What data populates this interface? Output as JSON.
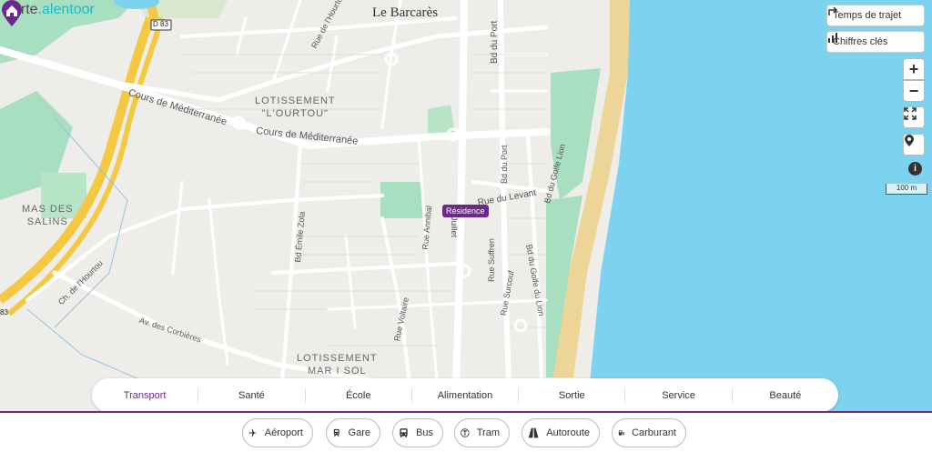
{
  "logo": {
    "part1": "carte",
    "dot": ".",
    "part2": "alentoor"
  },
  "city": "Le Barcarès",
  "controls": {
    "travel_time": "Temps de trajet",
    "key_figures": "Chiffres clés",
    "zoom_in": "+",
    "zoom_out": "−",
    "scale": "100 m"
  },
  "map_labels": {
    "d83": "D 83",
    "d83b": "83",
    "rue_hourtou": "Rue de l'Hourtou",
    "bd_port_top": "Bd du Port",
    "cours_med1": "Cours de Méditerranée",
    "cours_med2": "Cours de Méditerranée",
    "lot_ourtou_1": "LOTISSEMENT",
    "lot_ourtou_2": "\"L'OURTOU\"",
    "mas_1": "MAS DES",
    "mas_2": "SALINS",
    "bd_emile_zola": "Bd Émile Zola",
    "rue_annibal": "Rue Annibal",
    "rue_levant": "Rue du Levant",
    "bd_port2": "Bd du Port",
    "bd_golfe_lion": "Bd du Golfe Lion",
    "rue_suffren": "Rue Suffren",
    "rue_surcouf": "Rue Surcouf",
    "bd_golfe_lion2": "Bd du Golfe du Lion",
    "juillet": "Juillet",
    "ch_hourtou": "Ch. de l'Hourtou",
    "av_corbieres": "Av. des Corbières",
    "rue_voltaire": "Rue Voltaire",
    "lot_mar_1": "LOTISSEMENT",
    "lot_mar_2": "MAR I SOL"
  },
  "residence_label": "Résidence",
  "tabs": [
    "Transport",
    "Santé",
    "École",
    "Alimentation",
    "Sortie",
    "Service",
    "Beauté"
  ],
  "active_tab": "Transport",
  "chips": [
    {
      "label": "Aéroport",
      "icon": "plane-icon"
    },
    {
      "label": "Gare",
      "icon": "train-icon"
    },
    {
      "label": "Bus",
      "icon": "bus-icon"
    },
    {
      "label": "Tram",
      "icon": "tram-icon"
    },
    {
      "label": "Autoroute",
      "icon": "highway-icon"
    },
    {
      "label": "Carburant",
      "icon": "fuel-icon"
    }
  ],
  "colors": {
    "accent": "#6b2a8a",
    "sea": "#7dd3ef",
    "beach": "#ecd596",
    "green": "#a8dfc0",
    "major_road": "#f5c842"
  }
}
